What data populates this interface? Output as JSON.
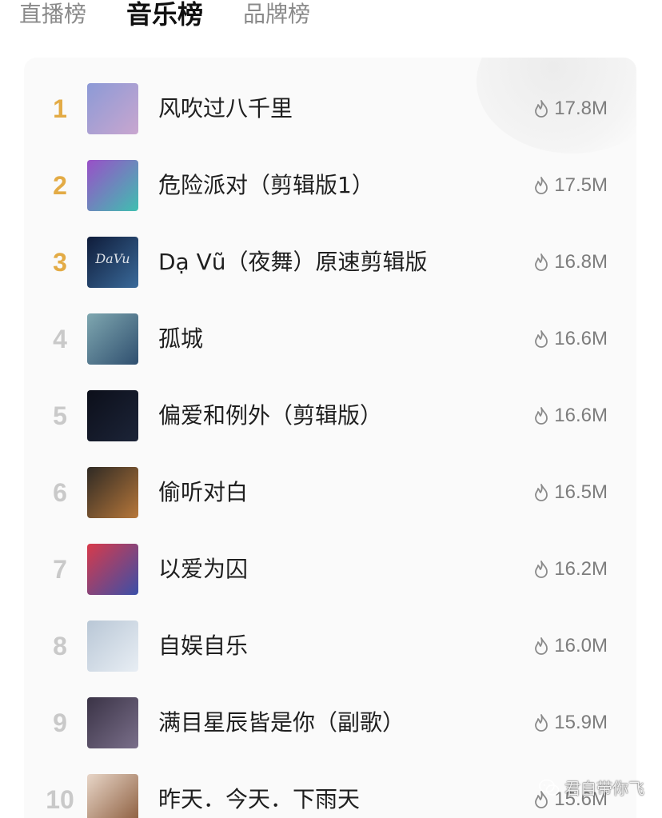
{
  "tabs": [
    {
      "label": "直播榜",
      "active": false
    },
    {
      "label": "音乐榜",
      "active": true
    },
    {
      "label": "品牌榜",
      "active": false
    }
  ],
  "colors": {
    "top_rank": "#e3ab45",
    "rank": "#c9c9c9",
    "title": "#1f1f1f",
    "heat": "#7d7d7d",
    "card_bg": "#fafafa"
  },
  "songs": [
    {
      "rank": "1",
      "title": "风吹过八千里",
      "heat": "17.8M",
      "heat_icon": "flame-icon",
      "cover_text": "",
      "cover": [
        "#8c9ad6",
        "#c9a6cf"
      ]
    },
    {
      "rank": "2",
      "title": "危险派对（剪辑版1）",
      "heat": "17.5M",
      "heat_icon": "flame-icon",
      "cover_text": "",
      "cover": [
        "#9a4fc8",
        "#3fbfb0"
      ]
    },
    {
      "rank": "3",
      "title": "Dạ Vũ（夜舞）原速剪辑版",
      "heat": "16.8M",
      "heat_icon": "flame-icon",
      "cover_text": "DaVu",
      "cover": [
        "#0f1c3a",
        "#3a6a9a"
      ]
    },
    {
      "rank": "4",
      "title": "孤城",
      "heat": "16.6M",
      "heat_icon": "flame-icon",
      "cover_text": "",
      "cover": [
        "#7fa7b0",
        "#2f4f6f"
      ]
    },
    {
      "rank": "5",
      "title": "偏爱和例外（剪辑版）",
      "heat": "16.6M",
      "heat_icon": "flame-icon",
      "cover_text": "",
      "cover": [
        "#0c0f1a",
        "#1c2438"
      ]
    },
    {
      "rank": "6",
      "title": "偷听对白",
      "heat": "16.5M",
      "heat_icon": "flame-icon",
      "cover_text": "",
      "cover": [
        "#2f2a24",
        "#b7773a"
      ]
    },
    {
      "rank": "7",
      "title": "以爱为囚",
      "heat": "16.2M",
      "heat_icon": "flame-icon",
      "cover_text": "",
      "cover": [
        "#d83a4a",
        "#3a4fa8"
      ]
    },
    {
      "rank": "8",
      "title": "自娱自乐",
      "heat": "16.0M",
      "heat_icon": "flame-icon",
      "cover_text": "",
      "cover": [
        "#b9c7d6",
        "#e8eef4"
      ]
    },
    {
      "rank": "9",
      "title": "满目星辰皆是你（副歌）",
      "heat": "15.9M",
      "heat_icon": "flame-icon",
      "cover_text": "",
      "cover": [
        "#3a3346",
        "#7a6f8a"
      ]
    },
    {
      "rank": "10",
      "title": "昨天．今天．下雨天",
      "heat": "15.6M",
      "heat_icon": "flame-icon",
      "cover_text": "",
      "cover": [
        "#e8d6c8",
        "#8a5a3a"
      ]
    }
  ],
  "watermark": {
    "icon": "wechat-icon",
    "text": "君自带你飞"
  }
}
